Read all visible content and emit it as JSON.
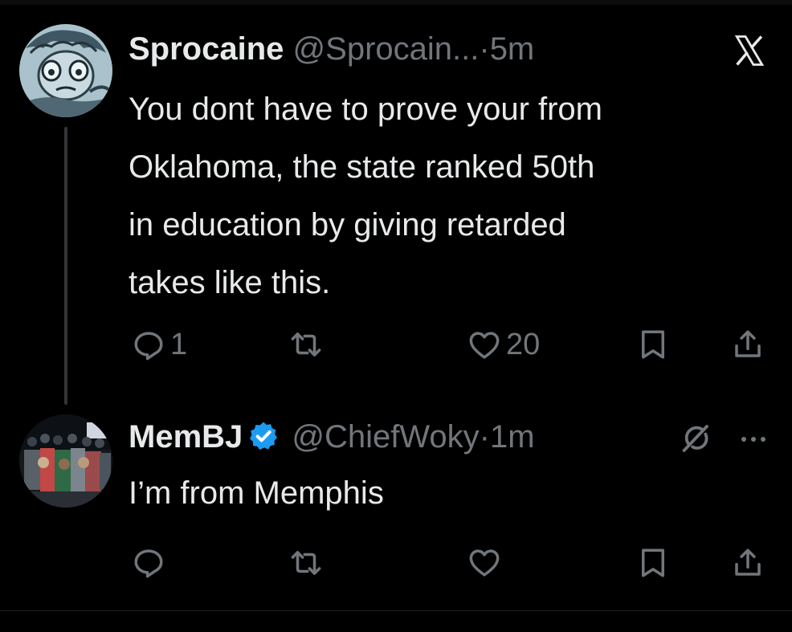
{
  "tweets": [
    {
      "display_name": "Sprocaine",
      "handle": "@Sprocain...",
      "separator": "·",
      "time": "5m",
      "avatar_icon": "cartoon-avatar",
      "body_lines": [
        "You dont have to prove your from",
        "Oklahoma, the state ranked 50th",
        "in education by giving retarded",
        "takes like this."
      ],
      "actions": {
        "reply_count": "1",
        "retweet_count": "",
        "like_count": "20"
      }
    },
    {
      "display_name": "MemBJ",
      "handle": "@ChiefWoky",
      "separator": "·",
      "time": "1m",
      "avatar_icon": "group-photo-avatar",
      "verified": true,
      "body_lines": [
        "I’m from Memphis"
      ],
      "actions": {
        "reply_count": "",
        "retweet_count": "",
        "like_count": ""
      }
    }
  ],
  "icons": {
    "close": "x-logo-icon",
    "grok": "grok-icon",
    "more": "more-dots-icon",
    "reply": "reply-icon",
    "retweet": "retweet-icon",
    "like": "heart-icon",
    "bookmark": "bookmark-icon",
    "share": "share-icon",
    "verified": "verified-badge-icon"
  },
  "colors": {
    "background": "#000000",
    "text_primary": "#e7e9ea",
    "text_secondary": "#71767b",
    "verified_blue": "#1d9bf0",
    "thread_line": "#333639"
  }
}
